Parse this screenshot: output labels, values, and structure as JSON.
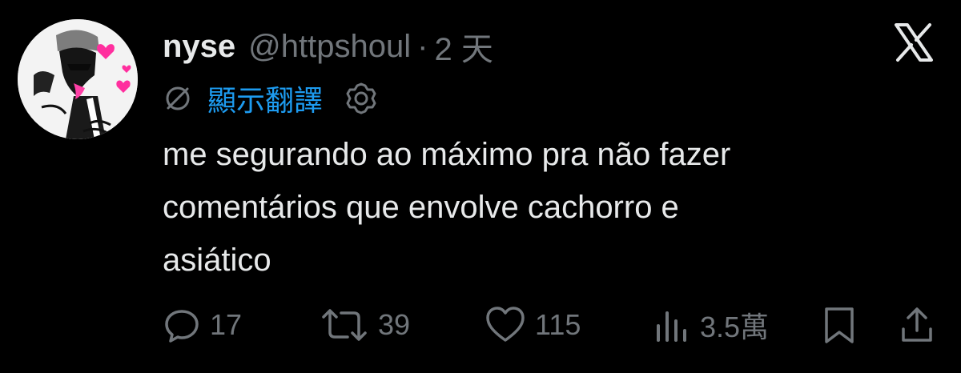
{
  "tweet": {
    "display_name": "nyse",
    "handle": "@httpshoul",
    "separator": "·",
    "time": "2 天",
    "translate_label": "顯示翻譯",
    "text_lines": [
      "me segurando ao máximo pra não fazer",
      "comentários que envolve cachorro e",
      "asiático"
    ]
  },
  "actions": {
    "reply_count": "17",
    "retweet_count": "39",
    "like_count": "115",
    "views_count": "3.5萬"
  },
  "icons": {
    "close": "x-logo-icon",
    "translate": "globe-slash-icon",
    "settings": "gear-icon",
    "reply": "reply-icon",
    "retweet": "retweet-icon",
    "like": "heart-icon",
    "views": "views-icon",
    "bookmark": "bookmark-icon",
    "share": "share-icon"
  },
  "colors": {
    "background": "#000000",
    "primary_text": "#e7e9ea",
    "secondary_text": "#71767b",
    "link": "#1d9bf0"
  }
}
